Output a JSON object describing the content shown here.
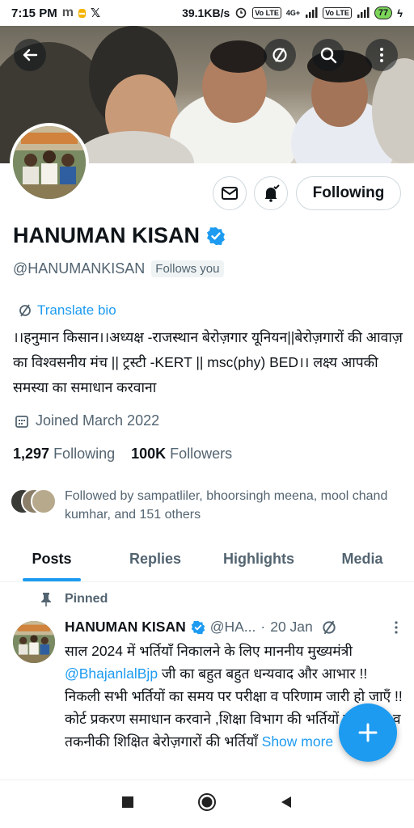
{
  "status_bar": {
    "time": "7:15 PM",
    "net_speed": "39.1KB/s",
    "battery": "77",
    "volte1": "Vo LTE",
    "volte2": "Vo LTE",
    "net_type": "4G+"
  },
  "header": {
    "back_icon": "arrow-left-icon",
    "translate_icon": "translate-icon",
    "search_icon": "search-icon",
    "more_icon": "more-vertical-icon"
  },
  "profile": {
    "display_name": "HANUMAN KISAN",
    "verified_color": "#1d9bf0",
    "handle": "@HANUMANKISAN",
    "follows_you": "Follows you",
    "translate_bio": "Translate bio",
    "bio": "।।हनुमान किसान।।अध्यक्ष -राजस्थान बेरोज़गार यूनियन||बेरोज़गारों की आवाज़ का विश्वसनीय मंच || ट्रस्टी -KERT || msc(phy) BED।। लक्ष्य आपकी समस्या का समाधान करवाना",
    "joined": "Joined March 2022",
    "following_count": "1,297",
    "following_label": "Following",
    "followers_count": "100K",
    "followers_label": "Followers",
    "followed_by": "Followed by sampatliler, bhoorsingh meena, mool chand kumhar, and 151 others",
    "following_button": "Following"
  },
  "tabs": [
    {
      "label": "Posts",
      "active": true
    },
    {
      "label": "Replies",
      "active": false
    },
    {
      "label": "Highlights",
      "active": false
    },
    {
      "label": "Media",
      "active": false
    }
  ],
  "pinned_post": {
    "pinned_label": "Pinned",
    "name": "HANUMAN KISAN",
    "handle": "@HA...",
    "separator": "·",
    "date": "20 Jan",
    "text_1": "साल 2024 में भर्तियाँ निकालने के लिए माननीय मुख्यमंत्री",
    "mention": "@BhajanlalBjp",
    "text_2": " जी का बहुत बहुत धन्यवाद और आभार !! निकली सभी भर्तियों का समय पर परीक्षा व परिणाम जारी हो जाएँ !!",
    "text_3": "कोर्ट प्रकरण समाधान करवाने ,शिक्षा विभाग की भर्तियों को बढ़ाने व तकनीकी शिक्षित बेरोज़गारों की भर्तियाँ",
    "show_more": "Show more"
  },
  "colors": {
    "accent": "#1d9bf0",
    "text_primary": "#0f1419",
    "text_secondary": "#536471"
  }
}
